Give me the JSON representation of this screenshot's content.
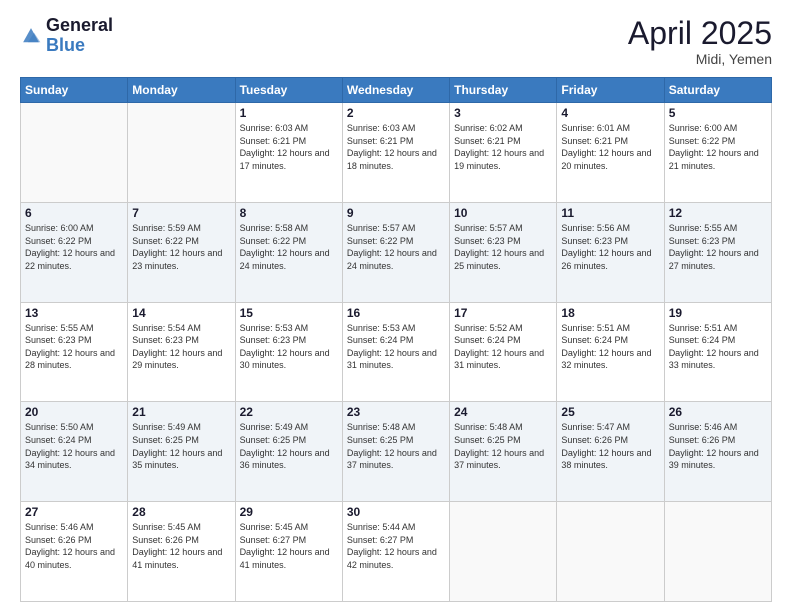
{
  "header": {
    "logo_general": "General",
    "logo_blue": "Blue",
    "month_title": "April 2025",
    "location": "Midi, Yemen"
  },
  "days_of_week": [
    "Sunday",
    "Monday",
    "Tuesday",
    "Wednesday",
    "Thursday",
    "Friday",
    "Saturday"
  ],
  "weeks": [
    [
      {
        "day": "",
        "sunrise": "",
        "sunset": "",
        "daylight": ""
      },
      {
        "day": "",
        "sunrise": "",
        "sunset": "",
        "daylight": ""
      },
      {
        "day": "1",
        "sunrise": "Sunrise: 6:03 AM",
        "sunset": "Sunset: 6:21 PM",
        "daylight": "Daylight: 12 hours and 17 minutes."
      },
      {
        "day": "2",
        "sunrise": "Sunrise: 6:03 AM",
        "sunset": "Sunset: 6:21 PM",
        "daylight": "Daylight: 12 hours and 18 minutes."
      },
      {
        "day": "3",
        "sunrise": "Sunrise: 6:02 AM",
        "sunset": "Sunset: 6:21 PM",
        "daylight": "Daylight: 12 hours and 19 minutes."
      },
      {
        "day": "4",
        "sunrise": "Sunrise: 6:01 AM",
        "sunset": "Sunset: 6:21 PM",
        "daylight": "Daylight: 12 hours and 20 minutes."
      },
      {
        "day": "5",
        "sunrise": "Sunrise: 6:00 AM",
        "sunset": "Sunset: 6:22 PM",
        "daylight": "Daylight: 12 hours and 21 minutes."
      }
    ],
    [
      {
        "day": "6",
        "sunrise": "Sunrise: 6:00 AM",
        "sunset": "Sunset: 6:22 PM",
        "daylight": "Daylight: 12 hours and 22 minutes."
      },
      {
        "day": "7",
        "sunrise": "Sunrise: 5:59 AM",
        "sunset": "Sunset: 6:22 PM",
        "daylight": "Daylight: 12 hours and 23 minutes."
      },
      {
        "day": "8",
        "sunrise": "Sunrise: 5:58 AM",
        "sunset": "Sunset: 6:22 PM",
        "daylight": "Daylight: 12 hours and 24 minutes."
      },
      {
        "day": "9",
        "sunrise": "Sunrise: 5:57 AM",
        "sunset": "Sunset: 6:22 PM",
        "daylight": "Daylight: 12 hours and 24 minutes."
      },
      {
        "day": "10",
        "sunrise": "Sunrise: 5:57 AM",
        "sunset": "Sunset: 6:23 PM",
        "daylight": "Daylight: 12 hours and 25 minutes."
      },
      {
        "day": "11",
        "sunrise": "Sunrise: 5:56 AM",
        "sunset": "Sunset: 6:23 PM",
        "daylight": "Daylight: 12 hours and 26 minutes."
      },
      {
        "day": "12",
        "sunrise": "Sunrise: 5:55 AM",
        "sunset": "Sunset: 6:23 PM",
        "daylight": "Daylight: 12 hours and 27 minutes."
      }
    ],
    [
      {
        "day": "13",
        "sunrise": "Sunrise: 5:55 AM",
        "sunset": "Sunset: 6:23 PM",
        "daylight": "Daylight: 12 hours and 28 minutes."
      },
      {
        "day": "14",
        "sunrise": "Sunrise: 5:54 AM",
        "sunset": "Sunset: 6:23 PM",
        "daylight": "Daylight: 12 hours and 29 minutes."
      },
      {
        "day": "15",
        "sunrise": "Sunrise: 5:53 AM",
        "sunset": "Sunset: 6:23 PM",
        "daylight": "Daylight: 12 hours and 30 minutes."
      },
      {
        "day": "16",
        "sunrise": "Sunrise: 5:53 AM",
        "sunset": "Sunset: 6:24 PM",
        "daylight": "Daylight: 12 hours and 31 minutes."
      },
      {
        "day": "17",
        "sunrise": "Sunrise: 5:52 AM",
        "sunset": "Sunset: 6:24 PM",
        "daylight": "Daylight: 12 hours and 31 minutes."
      },
      {
        "day": "18",
        "sunrise": "Sunrise: 5:51 AM",
        "sunset": "Sunset: 6:24 PM",
        "daylight": "Daylight: 12 hours and 32 minutes."
      },
      {
        "day": "19",
        "sunrise": "Sunrise: 5:51 AM",
        "sunset": "Sunset: 6:24 PM",
        "daylight": "Daylight: 12 hours and 33 minutes."
      }
    ],
    [
      {
        "day": "20",
        "sunrise": "Sunrise: 5:50 AM",
        "sunset": "Sunset: 6:24 PM",
        "daylight": "Daylight: 12 hours and 34 minutes."
      },
      {
        "day": "21",
        "sunrise": "Sunrise: 5:49 AM",
        "sunset": "Sunset: 6:25 PM",
        "daylight": "Daylight: 12 hours and 35 minutes."
      },
      {
        "day": "22",
        "sunrise": "Sunrise: 5:49 AM",
        "sunset": "Sunset: 6:25 PM",
        "daylight": "Daylight: 12 hours and 36 minutes."
      },
      {
        "day": "23",
        "sunrise": "Sunrise: 5:48 AM",
        "sunset": "Sunset: 6:25 PM",
        "daylight": "Daylight: 12 hours and 37 minutes."
      },
      {
        "day": "24",
        "sunrise": "Sunrise: 5:48 AM",
        "sunset": "Sunset: 6:25 PM",
        "daylight": "Daylight: 12 hours and 37 minutes."
      },
      {
        "day": "25",
        "sunrise": "Sunrise: 5:47 AM",
        "sunset": "Sunset: 6:26 PM",
        "daylight": "Daylight: 12 hours and 38 minutes."
      },
      {
        "day": "26",
        "sunrise": "Sunrise: 5:46 AM",
        "sunset": "Sunset: 6:26 PM",
        "daylight": "Daylight: 12 hours and 39 minutes."
      }
    ],
    [
      {
        "day": "27",
        "sunrise": "Sunrise: 5:46 AM",
        "sunset": "Sunset: 6:26 PM",
        "daylight": "Daylight: 12 hours and 40 minutes."
      },
      {
        "day": "28",
        "sunrise": "Sunrise: 5:45 AM",
        "sunset": "Sunset: 6:26 PM",
        "daylight": "Daylight: 12 hours and 41 minutes."
      },
      {
        "day": "29",
        "sunrise": "Sunrise: 5:45 AM",
        "sunset": "Sunset: 6:27 PM",
        "daylight": "Daylight: 12 hours and 41 minutes."
      },
      {
        "day": "30",
        "sunrise": "Sunrise: 5:44 AM",
        "sunset": "Sunset: 6:27 PM",
        "daylight": "Daylight: 12 hours and 42 minutes."
      },
      {
        "day": "",
        "sunrise": "",
        "sunset": "",
        "daylight": ""
      },
      {
        "day": "",
        "sunrise": "",
        "sunset": "",
        "daylight": ""
      },
      {
        "day": "",
        "sunrise": "",
        "sunset": "",
        "daylight": ""
      }
    ]
  ]
}
